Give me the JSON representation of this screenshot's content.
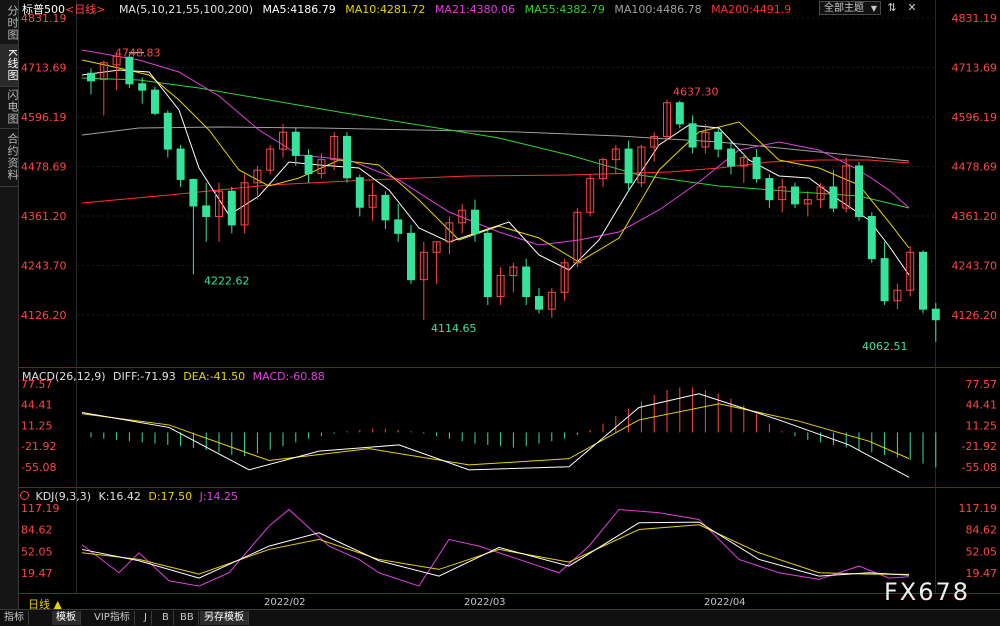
{
  "side_tabs": [
    {
      "label": "分时图",
      "active": false
    },
    {
      "label": "K线图",
      "active": true
    },
    {
      "label": "闪电图",
      "active": false
    },
    {
      "label": "合约资料",
      "active": false
    }
  ],
  "header": {
    "symbol": "标普500",
    "period": "<日线>",
    "ma_label": "MA(5,10,21,55,100,200)",
    "ma5": "MA5:4186.79",
    "ma10": "MA10:4281.72",
    "ma21": "MA21:4380.06",
    "ma55": "MA55:4382.79",
    "ma100": "MA100:4486.78",
    "ma200": "MA200:4491.9",
    "theme": "全部主题",
    "theme_arrow": "▼",
    "toggle": "⇅",
    "close": "✕"
  },
  "price_axis": {
    "ticks": [
      "4831.19",
      "4713.69",
      "4596.19",
      "4478.69",
      "4361.20",
      "4243.70",
      "4126.20"
    ]
  },
  "annotations": {
    "high1": "4748.83",
    "low1": "4222.62",
    "low2": "4114.65",
    "high2": "4637.30",
    "low3": "4062.51"
  },
  "macd": {
    "label": "MACD(26,12,9)",
    "diff": "DIFF:-71.93",
    "dea": "DEA:-41.50",
    "macd": "MACD:-60.88",
    "ticks": [
      "77.57",
      "44.41",
      "11.25",
      "-21.92",
      "-55.08"
    ]
  },
  "kdj": {
    "label": "KDJ(9,3,3)",
    "k": "K:16.42",
    "d": "D:17.50",
    "j": "J:14.25",
    "ticks": [
      "117.19",
      "84.62",
      "52.05",
      "19.47"
    ]
  },
  "time_axis": {
    "labels": [
      "2022/02",
      "2022/03",
      "2022/04"
    ]
  },
  "period_button": "日线 ▲",
  "bottom_tabs": [
    {
      "label": "指标",
      "active": false
    },
    {
      "label": "模板",
      "active": true
    },
    {
      "label": "VIP指标",
      "active": false
    },
    {
      "label": "J",
      "active": false
    },
    {
      "label": "B",
      "active": false
    },
    {
      "label": "BB",
      "active": false
    },
    {
      "label": "另存模板",
      "active": true
    }
  ],
  "watermark": "FX678",
  "colors": {
    "up": "#ff4545",
    "down": "#35e49a",
    "ma5": "#ffffff",
    "ma10": "#e8d200",
    "ma21": "#e040e0",
    "ma55": "#32d032",
    "ma100": "#a0a0a0",
    "ma200": "#ff3030",
    "axis": "#ff4545"
  }
}
